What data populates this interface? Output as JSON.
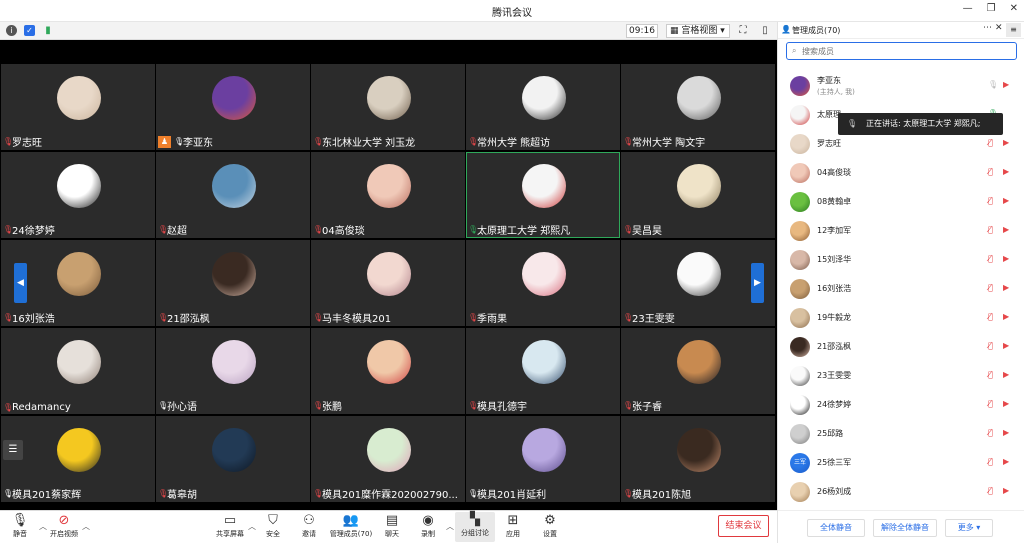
{
  "window": {
    "title": "腾讯会议",
    "controls": [
      "minimize-icon",
      "restore-icon",
      "close-icon"
    ]
  },
  "topbar": {
    "time": "09:16",
    "view_label": "宫格视图",
    "view_caret": "▾",
    "info_icon": "info-icon",
    "shield_icon": "shield-icon",
    "signal_icon": "signal-icon"
  },
  "tiles": [
    {
      "name": "罗志旺",
      "muted": true,
      "avatar": [
        "#e8d8c8",
        "#c9b39c"
      ]
    },
    {
      "name": "李亚东",
      "muted": false,
      "host": true,
      "avatar": [
        "#6b3fa0",
        "#e05a3a"
      ]
    },
    {
      "name": "东北林业大学 刘玉龙",
      "muted": true,
      "avatar": [
        "#d9cfc0",
        "#6b5a48"
      ]
    },
    {
      "name": "常州大学 熊超访",
      "muted": true,
      "avatar": [
        "#f2f2f2",
        "#222222"
      ]
    },
    {
      "name": "常州大学 陶文宇",
      "muted": true,
      "avatar": [
        "#dadada",
        "#555555"
      ]
    },
    {
      "name": "24徐梦婷",
      "muted": true,
      "avatar": [
        "#ffffff",
        "#111111"
      ]
    },
    {
      "name": "赵超",
      "muted": true,
      "avatar": [
        "#5a8fb8",
        "#c7d6e2"
      ]
    },
    {
      "name": "04高俊琰",
      "muted": true,
      "avatar": [
        "#f0c9b8",
        "#b86a5c"
      ]
    },
    {
      "name": "太原理工大学 郑熙凡",
      "muted": false,
      "speaking": true,
      "avatar": [
        "#f5f5f5",
        "#cc3333"
      ]
    },
    {
      "name": "吴昌昊",
      "muted": true,
      "avatar": [
        "#efe3c8",
        "#8a7a5c"
      ]
    },
    {
      "name": "16刘张浩",
      "muted": true,
      "avatar": [
        "#c8a070",
        "#7a5a3a"
      ]
    },
    {
      "name": "21邵泓枫",
      "muted": true,
      "avatar": [
        "#3a2a22",
        "#d8b8a8"
      ]
    },
    {
      "name": "马丰冬模具201",
      "muted": true,
      "avatar": [
        "#f2d8d0",
        "#b0808a"
      ]
    },
    {
      "name": "季雨果",
      "muted": true,
      "avatar": [
        "#f8e8ea",
        "#d86a7a"
      ]
    },
    {
      "name": "23王雯雯",
      "muted": true,
      "avatar": [
        "#fafafa",
        "#333333"
      ]
    },
    {
      "name": "Redamancy",
      "muted": true,
      "avatar": [
        "#e6e0da",
        "#8a7a70"
      ]
    },
    {
      "name": "孙心语",
      "muted": false,
      "avatar": [
        "#e8d8e8",
        "#b8a0c0"
      ]
    },
    {
      "name": "张鹏",
      "muted": true,
      "avatar": [
        "#f0c8a8",
        "#d04040"
      ]
    },
    {
      "name": "模具孔德宇",
      "muted": true,
      "avatar": [
        "#d8e8f0",
        "#304a6a"
      ]
    },
    {
      "name": "张子睿",
      "muted": true,
      "avatar": [
        "#c88a50",
        "#1a1a22"
      ]
    },
    {
      "name": "模具201蔡家辉",
      "muted": false,
      "avatar": [
        "#f4c820",
        "#222222"
      ]
    },
    {
      "name": "葛皋胡",
      "muted": true,
      "avatar": [
        "#223a55",
        "#0d1622"
      ]
    },
    {
      "name": "模具201糜作霖202002790...",
      "muted": true,
      "avatar": [
        "#d8ecd0",
        "#e0a0b8"
      ]
    },
    {
      "name": "模具201肖延利",
      "muted": false,
      "avatar": [
        "#b8a8e0",
        "#5a4a8a"
      ]
    },
    {
      "name": "模具201陈旭",
      "muted": true,
      "avatar": [
        "#3a2a20",
        "#c89070"
      ]
    }
  ],
  "pager": {
    "prev": "◀",
    "next": "▶"
  },
  "bottombar": {
    "mute_label": "静音",
    "video_label": "开启视频",
    "share_label": "共享屏幕",
    "security_label": "安全",
    "invite_label": "邀请",
    "members_label": "管理成员(70)",
    "chat_label": "聊天",
    "record_label": "录制",
    "breakout_label": "分组讨论",
    "apps_label": "应用",
    "settings_label": "设置",
    "end_label": "结束会议"
  },
  "panel": {
    "title": "管理成员(70)",
    "search_placeholder": "搜索成员",
    "tooltip": "正在讲话: 太原理工大学 郑熙凡;",
    "members": [
      {
        "name": "李亚东",
        "sub": "(主持人, 我)",
        "mic": "ok",
        "cam": true,
        "avatar": [
          "#6b3fa0",
          "#e05a3a"
        ]
      },
      {
        "name": "太原理",
        "mic": "live",
        "cam": false,
        "avatar": [
          "#f5f5f5",
          "#cc3333"
        ]
      },
      {
        "name": "罗志旺",
        "mic": "off",
        "cam": true,
        "avatar": [
          "#e8d8c8",
          "#c9b39c"
        ]
      },
      {
        "name": "04高俊琰",
        "mic": "off",
        "cam": true,
        "avatar": [
          "#f0c9b8",
          "#b86a5c"
        ]
      },
      {
        "name": "08黄翰卓",
        "mic": "off",
        "cam": true,
        "avatar": [
          "#6ac040",
          "#2a7a20"
        ]
      },
      {
        "name": "12李加军",
        "mic": "off",
        "cam": true,
        "avatar": [
          "#e8b880",
          "#8a5a30"
        ]
      },
      {
        "name": "15刘泽华",
        "mic": "off",
        "cam": true,
        "avatar": [
          "#d8b8a8",
          "#7a5a4a"
        ]
      },
      {
        "name": "16刘张浩",
        "mic": "off",
        "cam": true,
        "avatar": [
          "#c8a070",
          "#7a5a3a"
        ]
      },
      {
        "name": "19牛毅龙",
        "mic": "off",
        "cam": true,
        "avatar": [
          "#d8c0a0",
          "#8a6a4a"
        ]
      },
      {
        "name": "21邵泓枫",
        "mic": "off",
        "cam": true,
        "avatar": [
          "#3a2a22",
          "#d8b8a8"
        ]
      },
      {
        "name": "23王雯雯",
        "mic": "off",
        "cam": true,
        "avatar": [
          "#fafafa",
          "#333333"
        ]
      },
      {
        "name": "24徐梦婷",
        "mic": "off",
        "cam": true,
        "avatar": [
          "#ffffff",
          "#111111"
        ]
      },
      {
        "name": "25邱路",
        "mic": "off",
        "cam": true,
        "avatar": [
          "#cfcfcf",
          "#7a7a7a"
        ]
      },
      {
        "name": "25徐三军",
        "mic": "off",
        "cam": true,
        "avatar_text": "三军",
        "avatar": [
          "#2a78e8",
          "#1a5ac8"
        ]
      },
      {
        "name": "26杨刘成",
        "mic": "off",
        "cam": true,
        "avatar": [
          "#e8d0b0",
          "#a07a50"
        ]
      }
    ],
    "footer": {
      "mute_all": "全体静音",
      "unmute_all": "解除全体静音",
      "more": "更多 ▾"
    }
  },
  "colors": {
    "accent": "#2a6ee6",
    "danger": "#e0393e",
    "speaking": "#2fa85a",
    "tile_bg": "#2b2b2b",
    "host_badge": "#f0802b"
  }
}
